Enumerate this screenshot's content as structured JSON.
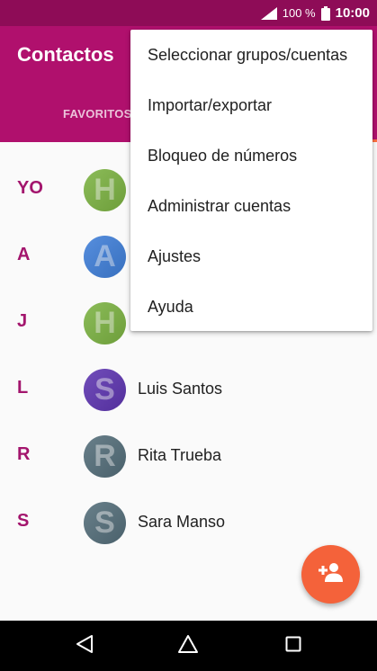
{
  "status_bar": {
    "battery_percent": "100 %",
    "time": "10:00",
    "signal_icon": "signal-icon",
    "battery_icon": "battery-icon"
  },
  "app_bar": {
    "title": "Contactos",
    "tabs": [
      {
        "label": "FAVORITOS"
      }
    ],
    "color": "#b0106d"
  },
  "contacts": [
    {
      "section": "YO",
      "name": "",
      "initial": "H",
      "avatar_color": "#7cb342"
    },
    {
      "section": "A",
      "name": "",
      "initial": "A",
      "avatar_color": "#3f7fd9"
    },
    {
      "section": "J",
      "name": "",
      "initial": "H",
      "avatar_color": "#7cb342"
    },
    {
      "section": "L",
      "name": "Luis Santos",
      "initial": "S",
      "avatar_color": "#5e35b1"
    },
    {
      "section": "R",
      "name": "Rita Trueba",
      "initial": "R",
      "avatar_color": "#546e7a"
    },
    {
      "section": "S",
      "name": "Sara Manso",
      "initial": "S",
      "avatar_color": "#546e7a"
    }
  ],
  "overflow_menu": {
    "items": [
      {
        "label": "Seleccionar grupos/cuentas"
      },
      {
        "label": "Importar/exportar"
      },
      {
        "label": "Bloqueo de números"
      },
      {
        "label": "Administrar cuentas"
      },
      {
        "label": "Ajustes"
      },
      {
        "label": "Ayuda"
      }
    ]
  },
  "fab": {
    "icon": "add-person-icon",
    "color": "#f4623a"
  },
  "nav_bar": {
    "icons": [
      "back-icon",
      "home-icon",
      "recents-icon"
    ]
  }
}
